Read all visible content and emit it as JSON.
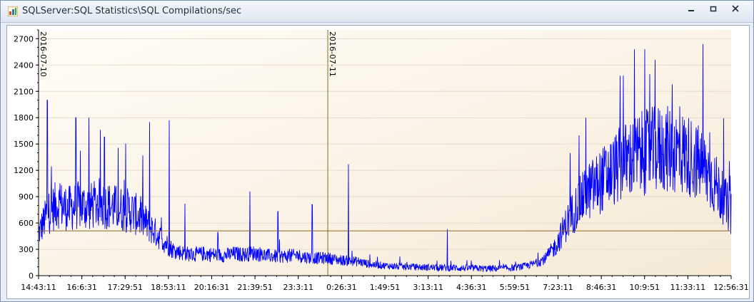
{
  "window": {
    "title": "SQLServer:SQL Statistics\\SQL Compilations/sec",
    "icons": {
      "app": "chart-app-icon",
      "minimize": "minimize-icon",
      "restore": "restore-icon",
      "close": "close-icon"
    }
  },
  "colors": {
    "series": "#0000ff",
    "plot_bg_start": "#fffdf7",
    "plot_bg_end": "#f6ead6",
    "reference_line": "#8a6a2c",
    "day_marker": "#8a6a2c",
    "grid": "#e6dccb"
  },
  "chart_data": {
    "type": "line",
    "title": "SQLServer:SQL Statistics\\SQL Compilations/sec",
    "xlabel": "",
    "ylabel": "",
    "ylim": [
      0,
      2800
    ],
    "y_ticks": [
      0,
      300,
      600,
      900,
      1200,
      1500,
      1800,
      2100,
      2400,
      2700
    ],
    "x_tick_labels": [
      "14:43:11",
      "16:6:31",
      "17:29:51",
      "18:53:11",
      "20:16:31",
      "21:39:51",
      "23:3:11",
      "0:26:31",
      "1:49:51",
      "3:13:11",
      "4:36:31",
      "5:59:51",
      "7:23:11",
      "8:46:31",
      "10:9:51",
      "11:33:11",
      "12:56:31"
    ],
    "grid": true,
    "legend": "none",
    "reference_line": {
      "value": 510
    },
    "day_markers": [
      {
        "label": "2016-07-10",
        "x": "14:43:11"
      },
      {
        "label": "2016-07-11",
        "x": "0:00:00"
      }
    ],
    "series": [
      {
        "x": [
          "14:43:11",
          "15:00",
          "15:20",
          "15:40",
          "16:00",
          "16:20",
          "16:40",
          "17:00",
          "17:20",
          "17:40",
          "18:00",
          "18:20",
          "18:40",
          "19:00",
          "19:20",
          "19:40",
          "20:00",
          "20:20",
          "20:40",
          "21:00",
          "21:20",
          "21:40",
          "22:00",
          "22:20",
          "22:40",
          "23:00",
          "23:20",
          "23:40",
          "0:00",
          "0:20",
          "0:40",
          "1:00",
          "1:20",
          "1:40",
          "2:00",
          "2:20",
          "2:40",
          "3:00",
          "3:20",
          "3:40",
          "4:00",
          "4:20",
          "4:40",
          "5:00",
          "5:20",
          "5:40",
          "6:00",
          "6:20",
          "6:40",
          "7:00",
          "7:20",
          "7:40",
          "8:00",
          "8:20",
          "8:40",
          "9:00",
          "9:20",
          "9:40",
          "10:00",
          "10:20",
          "10:40",
          "11:00",
          "11:20",
          "11:40",
          "12:00",
          "12:20",
          "12:40",
          "12:56:31"
        ],
        "values": [
          480,
          700,
          820,
          760,
          800,
          780,
          830,
          790,
          760,
          740,
          660,
          540,
          420,
          300,
          260,
          240,
          250,
          240,
          230,
          250,
          240,
          260,
          230,
          220,
          220,
          230,
          210,
          200,
          200,
          180,
          170,
          160,
          130,
          120,
          110,
          100,
          100,
          95,
          95,
          90,
          90,
          85,
          85,
          80,
          80,
          85,
          90,
          110,
          140,
          200,
          350,
          600,
          800,
          950,
          1050,
          1150,
          1250,
          1330,
          1380,
          1420,
          1450,
          1430,
          1400,
          1350,
          1250,
          1100,
          900,
          700
        ],
        "peaks": [
          {
            "x": "15:00",
            "y": 2000
          },
          {
            "x": "15:55",
            "y": 1800
          },
          {
            "x": "16:20",
            "y": 1800
          },
          {
            "x": "16:50",
            "y": 1580
          },
          {
            "x": "18:17",
            "y": 1750
          },
          {
            "x": "18:55",
            "y": 1770
          },
          {
            "x": "19:25",
            "y": 820
          },
          {
            "x": "21:30",
            "y": 960
          },
          {
            "x": "22:24",
            "y": 730
          },
          {
            "x": "23:30",
            "y": 810
          },
          {
            "x": "0:40",
            "y": 1270
          },
          {
            "x": "3:50",
            "y": 530
          },
          {
            "x": "8:17",
            "y": 1800
          },
          {
            "x": "9:29",
            "y": 2280
          },
          {
            "x": "9:50",
            "y": 2580
          },
          {
            "x": "10:10",
            "y": 2580
          },
          {
            "x": "10:30",
            "y": 2460
          },
          {
            "x": "11:03",
            "y": 2180
          },
          {
            "x": "12:40",
            "y": 850
          }
        ]
      }
    ]
  }
}
